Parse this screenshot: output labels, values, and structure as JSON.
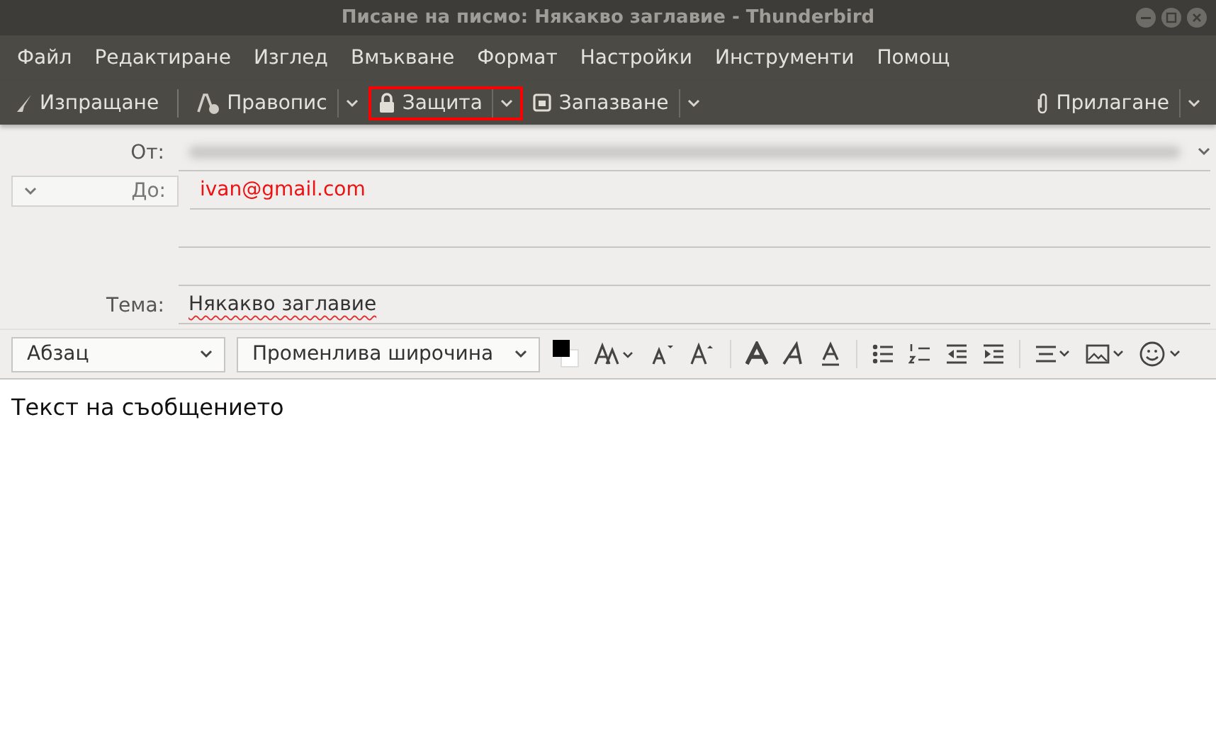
{
  "window": {
    "title": "Писане на писмо: Някакво заглавие - Thunderbird"
  },
  "menu": [
    {
      "label": "Файл"
    },
    {
      "label": "Редактиране"
    },
    {
      "label": "Изглед"
    },
    {
      "label": "Вмъкване"
    },
    {
      "label": "Формат"
    },
    {
      "label": "Настройки"
    },
    {
      "label": "Инструменти"
    },
    {
      "label": "Помощ"
    }
  ],
  "toolbar": [
    {
      "kind": "send",
      "label": "Изпращане",
      "dropdown": false,
      "highlighted": false
    },
    {
      "kind": "spelling",
      "label": "Правопис",
      "dropdown": true,
      "highlighted": false
    },
    {
      "kind": "security",
      "label": "Защита",
      "dropdown": true,
      "highlighted": true
    },
    {
      "kind": "save",
      "label": "Запазване",
      "dropdown": true,
      "highlighted": false
    },
    {
      "kind": "attach",
      "label": "Прилагане",
      "dropdown": true,
      "highlighted": false
    }
  ],
  "header": {
    "from": {
      "label": "От:"
    },
    "to": {
      "label": "До:",
      "value": "ivan@gmail.com"
    },
    "subject": {
      "label": "Тема:",
      "value": "Някакво заглавие",
      "misspelled": true
    }
  },
  "format_toolbar": {
    "paragraph": "Абзац",
    "font": "Променлива широчина"
  },
  "body": {
    "text": "Текст на съобщението"
  }
}
